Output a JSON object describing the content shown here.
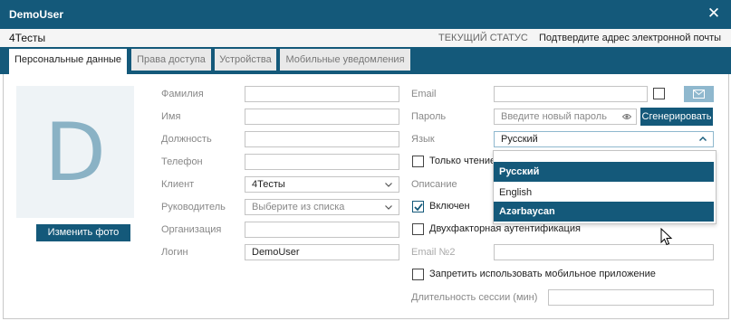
{
  "window": {
    "title": "DemoUser"
  },
  "subbar": {
    "client": "4Тесты",
    "status_label": "ТЕКУЩИЙ СТАТУС",
    "status_value": "Подтвердите адрес электронной почты"
  },
  "tabs": [
    {
      "label": "Персональные данные",
      "active": true
    },
    {
      "label": "Права доступа",
      "active": false
    },
    {
      "label": "Устройства",
      "active": false
    },
    {
      "label": "Мобильные уведомления",
      "active": false
    }
  ],
  "photo": {
    "letter": "D",
    "change_button": "Изменить фото"
  },
  "left_form": {
    "surname_label": "Фамилия",
    "name_label": "Имя",
    "position_label": "Должность",
    "phone_label": "Телефон",
    "client_label": "Клиент",
    "client_value": "4Тесты",
    "manager_label": "Руководитель",
    "manager_placeholder": "Выберите из списка",
    "org_label": "Организация",
    "login_label": "Логин",
    "login_value": "DemoUser"
  },
  "right_form": {
    "email_label": "Email",
    "password_label": "Пароль",
    "password_placeholder": "Введите новый пароль",
    "generate_button": "Сгенерировать",
    "language_label": "Язык",
    "language_value": "Русский",
    "readonly_label": "Только чтение",
    "readonly_checked": false,
    "description_label": "Описание",
    "enabled_label": "Включен",
    "enabled_checked": true,
    "twofactor_label": "Двухфакторная аутентификация",
    "twofactor_checked": false,
    "email2_label": "Email №2",
    "forbid_mobile_label": "Запретить использовать мобильное приложение",
    "forbid_mobile_checked": false,
    "session_label": "Длительность сессии (мин)"
  },
  "language_dropdown": {
    "options": [
      "Русский",
      "English",
      "Azərbaycan"
    ],
    "selected": "Русский",
    "highlighted": "Azərbaycan"
  },
  "colors": {
    "primary": "#14597a",
    "accent_light": "#8fb8ce",
    "photo_letter": "#8ab2c5"
  },
  "icons": {
    "close": "close-icon",
    "mail": "mail-icon",
    "eye": "eye-icon",
    "chevron": "chevron-down-icon",
    "check": "check-icon",
    "cursor": "mouse-cursor-icon"
  }
}
